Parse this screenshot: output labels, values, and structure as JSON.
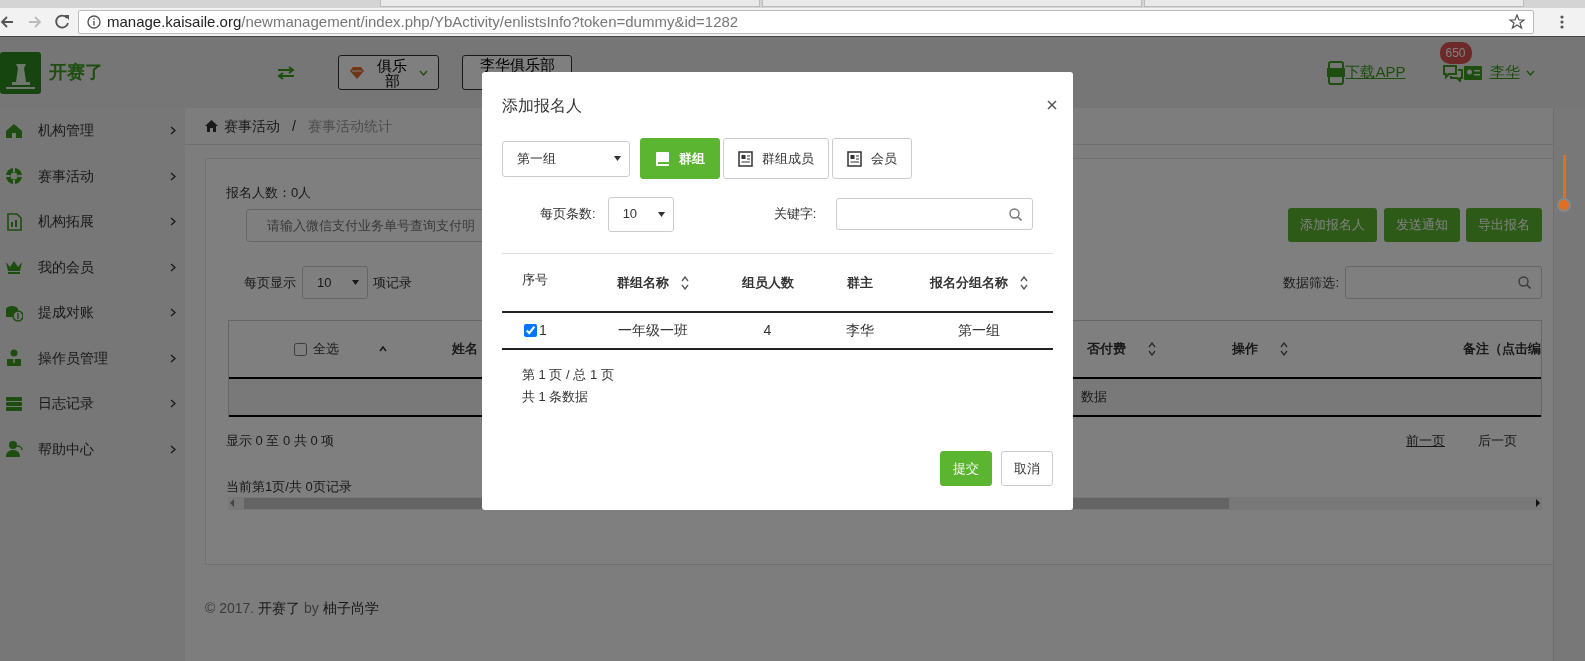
{
  "browser": {
    "url_host": "manage.kaisaile.org",
    "url_path": "/newmanagement/index.php/YbActivity/enlistsInfo?token=dummy&id=1282"
  },
  "header": {
    "logo_text": "开赛了",
    "type_select": "俱乐部",
    "club_select": "李华俱乐部",
    "download_app": "下载APP",
    "message_count": "650",
    "user_name": "李华"
  },
  "sidebar": {
    "items": [
      {
        "label": "机构管理"
      },
      {
        "label": "赛事活动"
      },
      {
        "label": "机构拓展"
      },
      {
        "label": "我的会员"
      },
      {
        "label": "提成对账"
      },
      {
        "label": "操作员管理"
      },
      {
        "label": "日志记录"
      },
      {
        "label": "帮助中心"
      }
    ]
  },
  "breadcrumb_separator": "/",
  "breadcrumb": [
    {
      "label": "赛事活动",
      "current": false
    },
    {
      "label": "赛事活动统计",
      "current": true
    }
  ],
  "page": {
    "count_text": "报名人数：0人",
    "search_placeholder": "请输入微信支付业务单号查询支付明",
    "actions": [
      "添加报名人",
      "发送通知",
      "导出报名"
    ],
    "page_size_prefix": "每页显示",
    "page_size": "10",
    "page_size_suffix": "项记录",
    "filter_label": "数据筛选:",
    "select_all": {
      "label": "全选",
      "checked": false
    },
    "columns": [
      {
        "label": "姓名",
        "sortable": false
      },
      {
        "label": "否付费",
        "sortable": true
      },
      {
        "label": "操作",
        "sortable": true
      },
      {
        "label": "备注（点击编",
        "sortable": false
      }
    ],
    "select_sorted_ascending": true,
    "empty_text": "数据",
    "info": "显示 0 至 0 共 0 项",
    "prev": "前一页",
    "next": "后一页",
    "summary": "当前第1页/共 0页记录"
  },
  "footer": {
    "copyright": "© 2017.",
    "brand": "开赛了",
    "by": "by",
    "company": "柚子尚学"
  },
  "modal": {
    "title": "添加报名人",
    "group_select": "第一组",
    "tabs": [
      {
        "label": "群组",
        "selected": true
      },
      {
        "label": "群组成员",
        "selected": false
      },
      {
        "label": "会员",
        "selected": false
      }
    ],
    "page_size_label": "每页条数:",
    "page_size": "10",
    "keyword_label": "关键字:",
    "columns": [
      {
        "label": "序号",
        "sortable": false
      },
      {
        "label": "群组名称",
        "sortable": true
      },
      {
        "label": "组员人数",
        "sortable": false
      },
      {
        "label": "群主",
        "sortable": false
      },
      {
        "label": "报名分组名称",
        "sortable": true
      }
    ],
    "rows": [
      {
        "checked": true,
        "index": "1",
        "name": "一年级一班",
        "members": "4",
        "owner": "李华",
        "group": "第一组"
      }
    ],
    "pager_text": "第 1 页 / 总 1 页",
    "total_text": "共 1 条数据",
    "buttons": [
      {
        "label": "提交",
        "kind": "primary"
      },
      {
        "label": "取消",
        "kind": "secondary"
      }
    ]
  }
}
